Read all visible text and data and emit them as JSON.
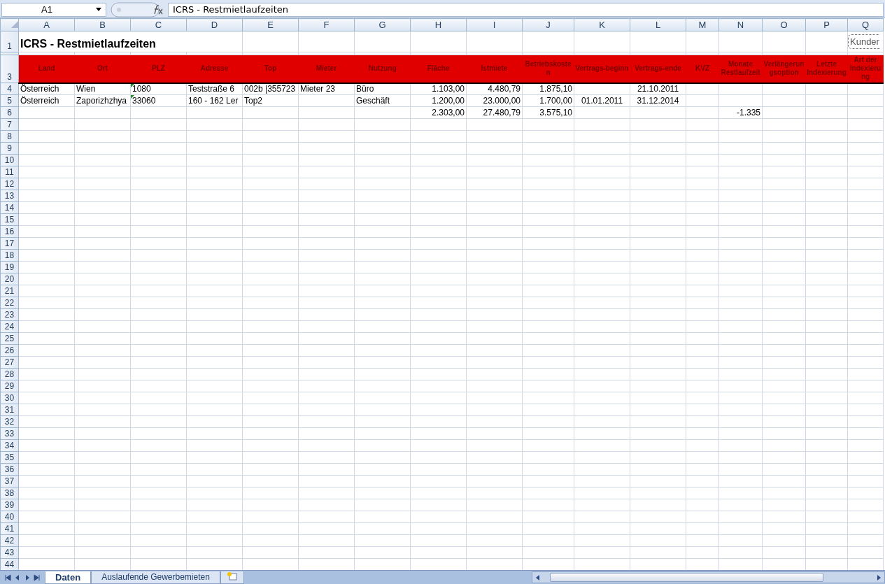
{
  "name_box": "A1",
  "formula": "ICRS - Restmietlaufzeiten",
  "columns": [
    "A",
    "B",
    "C",
    "D",
    "E",
    "F",
    "G",
    "H",
    "I",
    "J",
    "K",
    "L",
    "M",
    "N",
    "O",
    "P",
    "Q"
  ],
  "row_numbers": [
    "1",
    "3",
    "4",
    "5",
    "6",
    "7",
    "8",
    "9",
    "10",
    "11",
    "12",
    "13",
    "14",
    "15",
    "16",
    "17",
    "18",
    "19",
    "20",
    "21",
    "22",
    "23",
    "24",
    "25",
    "26",
    "27",
    "28",
    "29",
    "30",
    "31",
    "32",
    "33",
    "34",
    "35",
    "36",
    "37",
    "38",
    "39",
    "40",
    "41",
    "42",
    "43",
    "44"
  ],
  "title": "ICRS - Restmietlaufzeiten",
  "text_box": "Kunder",
  "header": [
    "Land",
    "Ort",
    "PLZ",
    "Adresse",
    "Top",
    "Mieter",
    "Nutzung",
    "Fläche",
    "Istmiete",
    "Betriebskosten",
    "Vertrags-beginn",
    "Vertrags-ende",
    "KVZ",
    "Monate Restlaufzeit",
    "Verlängerungsoption",
    "Letzte Indexierung",
    "Art der Indexierung"
  ],
  "rows": [
    [
      {
        "text": "Österreich",
        "kind": "text"
      },
      {
        "text": "Wien",
        "kind": "text"
      },
      {
        "text": "1080",
        "kind": "text",
        "flagged": true
      },
      {
        "text": "Teststraße 6",
        "kind": "text"
      },
      {
        "text": "002b |355723",
        "kind": "text"
      },
      {
        "text": "Mieter 23",
        "kind": "text"
      },
      {
        "text": "Büro",
        "kind": "text"
      },
      {
        "text": "1.103,00",
        "kind": "number"
      },
      {
        "text": "4.480,79",
        "kind": "number"
      },
      {
        "text": "1.875,10",
        "kind": "number"
      },
      null,
      {
        "text": "21.10.2011",
        "kind": "date"
      },
      null,
      null,
      null,
      null,
      null
    ],
    [
      {
        "text": "Österreich",
        "kind": "text"
      },
      {
        "text": "Zaporizhzhya",
        "kind": "text"
      },
      {
        "text": "33060",
        "kind": "text",
        "flagged": true
      },
      {
        "text": "160 - 162 Ler",
        "kind": "text"
      },
      {
        "text": "Top2",
        "kind": "text"
      },
      null,
      {
        "text": "Geschäft",
        "kind": "text"
      },
      {
        "text": "1.200,00",
        "kind": "number"
      },
      {
        "text": "23.000,00",
        "kind": "number"
      },
      {
        "text": "1.700,00",
        "kind": "number"
      },
      {
        "text": "01.01.2011",
        "kind": "date"
      },
      {
        "text": "31.12.2014",
        "kind": "date"
      },
      null,
      null,
      null,
      null,
      null
    ],
    [
      null,
      null,
      null,
      null,
      null,
      null,
      null,
      {
        "text": "2.303,00",
        "kind": "number"
      },
      {
        "text": "27.480,79",
        "kind": "number"
      },
      {
        "text": "3.575,10",
        "kind": "number"
      },
      null,
      null,
      null,
      {
        "text": "-1.335",
        "kind": "number"
      },
      null,
      null,
      null
    ]
  ],
  "sheet_tabs": [
    {
      "label": "Daten",
      "selected": true
    },
    {
      "label": "Auslaufende Gewerbemieten",
      "selected": false
    }
  ]
}
